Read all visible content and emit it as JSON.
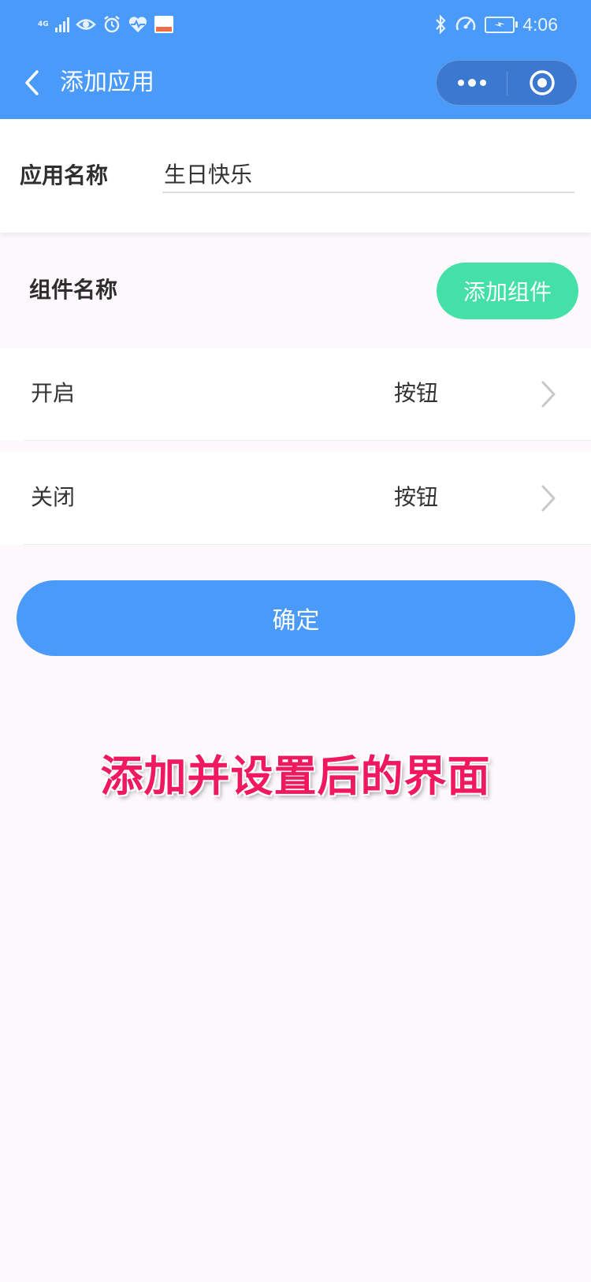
{
  "status_bar": {
    "network": "4G",
    "time": "4:06",
    "icons": [
      "signal-icon",
      "eye-icon",
      "alarm-icon",
      "heart-icon",
      "app-notification-icon",
      "bluetooth-icon",
      "speed-icon",
      "battery-charging-icon"
    ]
  },
  "nav": {
    "title": "添加应用",
    "back_icon": "chevron-left-icon",
    "more_icon": "more-dots-icon",
    "close_icon": "target-circle-icon"
  },
  "app_name": {
    "label": "应用名称",
    "value": "生日快乐"
  },
  "components": {
    "header_label": "组件名称",
    "add_button_label": "添加组件",
    "items": [
      {
        "name": "开启",
        "type": "按钮"
      },
      {
        "name": "关闭",
        "type": "按钮"
      }
    ]
  },
  "confirm_label": "确定",
  "caption": "添加并设置后的界面",
  "colors": {
    "primary": "#4a9afa",
    "accent_green": "#45e0a8",
    "caption_red": "#f0185e",
    "background": "#fcf8fc"
  }
}
